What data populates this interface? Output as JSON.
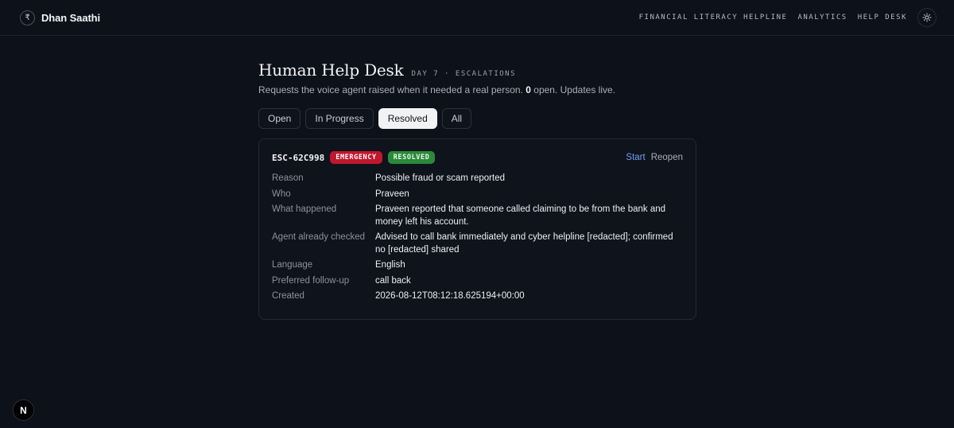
{
  "brand": {
    "name": "Dhan Saathi",
    "logo_glyph": "₹"
  },
  "nav": {
    "items": [
      "FINANCIAL LITERACY HELPLINE",
      "ANALYTICS",
      "HELP DESK"
    ],
    "theme_icon": "sun-icon"
  },
  "page": {
    "title": "Human Help Desk",
    "kicker": "DAY 7 · ESCALATIONS",
    "subtitle_pre": "Requests the voice agent raised when it needed a real person.",
    "open_count": "0",
    "subtitle_post": "open. Updates live."
  },
  "tabs": [
    {
      "label": "Open",
      "active": false
    },
    {
      "label": "In Progress",
      "active": false
    },
    {
      "label": "Resolved",
      "active": true
    },
    {
      "label": "All",
      "active": false
    }
  ],
  "ticket": {
    "id": "ESC-62C998",
    "priority_badge": "EMERGENCY",
    "status_badge": "RESOLVED",
    "actions": {
      "start": "Start",
      "reopen": "Reopen"
    },
    "fields": [
      {
        "key": "Reason",
        "value": "Possible fraud or scam reported"
      },
      {
        "key": "Who",
        "value": "Praveen"
      },
      {
        "key": "What happened",
        "value": "Praveen reported that someone called claiming to be from the bank and money left his account."
      },
      {
        "key": "Agent already checked",
        "value": "Advised to call bank immediately and cyber helpline [redacted]; confirmed no [redacted] shared"
      },
      {
        "key": "Language",
        "value": "English"
      },
      {
        "key": "Preferred follow-up",
        "value": "call back"
      },
      {
        "key": "Created",
        "value": "2026-08-12T08:12:18.625194+00:00"
      }
    ]
  },
  "dev_badge": {
    "letter": "N"
  },
  "colors": {
    "background": "#0d111a",
    "emergency": "#c0172d",
    "resolved": "#2a8a3a",
    "link": "#6f9ef0"
  }
}
